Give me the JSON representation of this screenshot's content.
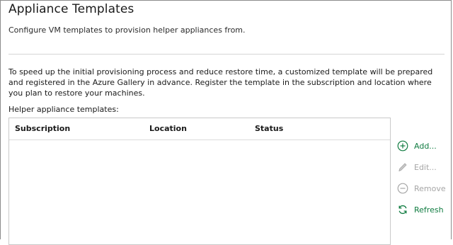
{
  "page": {
    "title": "Appliance Templates",
    "subtitle": "Configure VM templates to provision helper appliances from.",
    "description": "To speed up the initial provisioning process and reduce restore time, a customized template will be prepared and registered in the Azure Gallery in advance. Register the template in the subscription and location where you plan to restore your machines.",
    "list_label": "Helper appliance templates:"
  },
  "table": {
    "columns": [
      "Subscription",
      "Location",
      "Status"
    ],
    "rows": []
  },
  "actions": [
    {
      "label": "Add...",
      "icon": "add-circle-icon",
      "enabled": true
    },
    {
      "label": "Edit...",
      "icon": "pencil-icon",
      "enabled": false
    },
    {
      "label": "Remove",
      "icon": "remove-circle-icon",
      "enabled": false
    },
    {
      "label": "Refresh",
      "icon": "refresh-icon",
      "enabled": true
    }
  ],
  "colors": {
    "accent_green": "#107c41",
    "disabled_gray": "#a6a6a6"
  }
}
